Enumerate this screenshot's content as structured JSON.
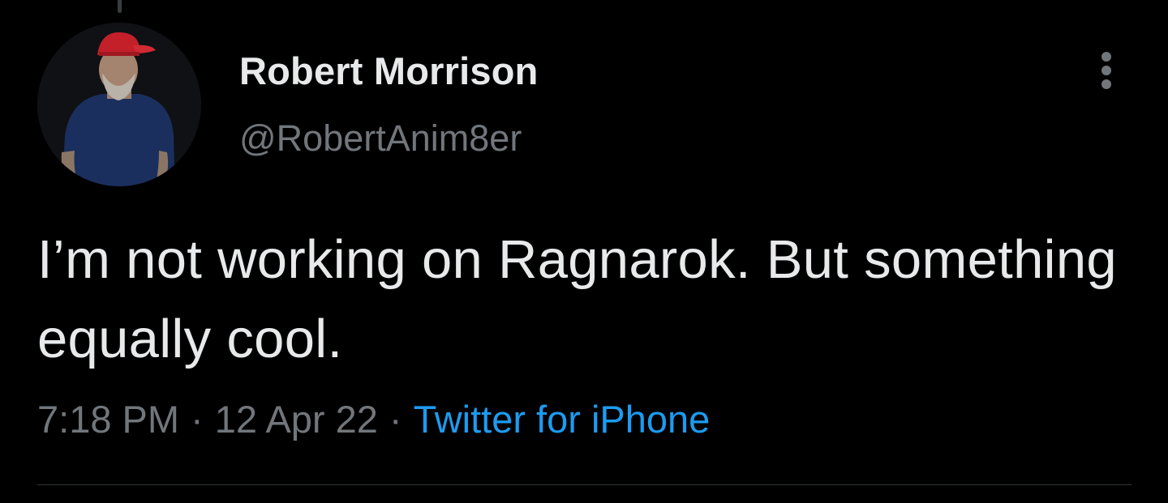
{
  "tweet": {
    "author": {
      "display_name": "Robert Morrison",
      "handle": "@RobertAnim8er",
      "avatar": "profile-photo"
    },
    "menu_icon": "more-vertical-icon",
    "text": "I’m not working on Ragnarok. But something equally cool.",
    "time": "7:18 PM",
    "separator": "·",
    "date": "12 Apr 22",
    "source": "Twitter for iPhone"
  },
  "colors": {
    "background": "#000000",
    "primary_text": "#e7e9ea",
    "secondary_text": "#71767b",
    "link": "#1d9bf0",
    "divider": "#2f3336"
  }
}
